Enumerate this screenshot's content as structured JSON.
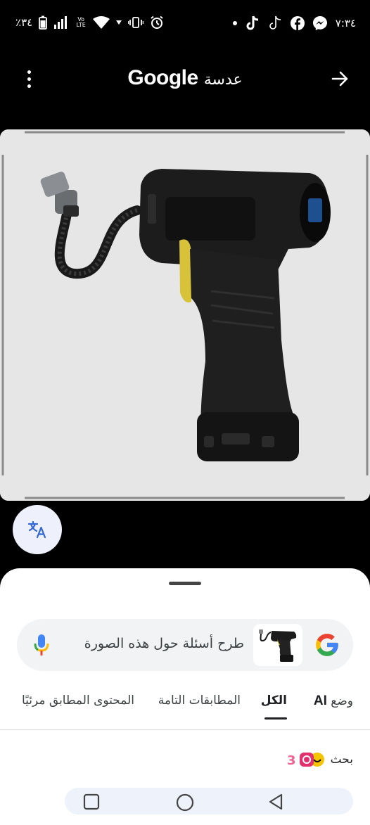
{
  "status_bar": {
    "battery_percent": "٪٣٤",
    "network_label": "Vo LTE",
    "time": "٧:٣٤",
    "notifications": [
      "dot-icon",
      "tiktok-icon",
      "tiktok-icon",
      "facebook-icon",
      "messenger-icon"
    ]
  },
  "app_bar": {
    "brand": "Google",
    "lens_label": "عدسة"
  },
  "search": {
    "placeholder": "طرح أسئلة حول هذه الصورة"
  },
  "tabs": {
    "ai_prefix": "وضع",
    "ai_label": "AI",
    "all": "الكل",
    "exact": "المطابقات التامة",
    "visual": "المحتوى المطابق مرئيًا"
  },
  "results": {
    "first_label": "بحث"
  },
  "colors": {
    "google_blue": "#4285F4",
    "google_red": "#EA4335",
    "google_yellow": "#FBBC05",
    "google_green": "#34A853",
    "translate_blue": "#3367d6"
  }
}
